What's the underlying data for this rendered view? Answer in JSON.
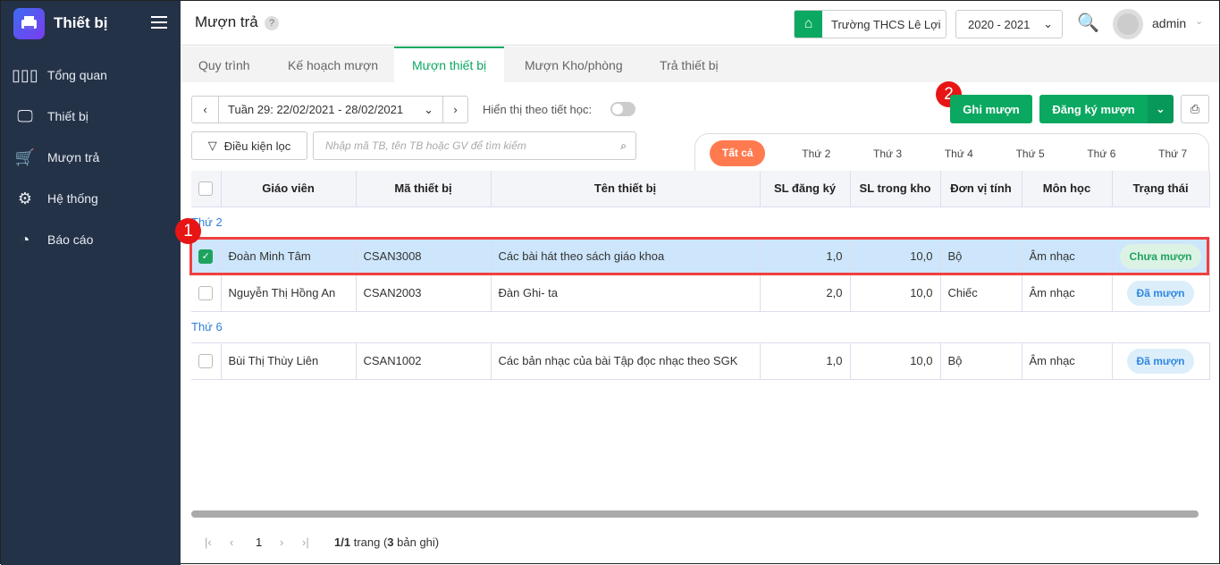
{
  "sidebar": {
    "brand": "Thiết bị",
    "items": [
      {
        "label": "Tổng quan",
        "icon": "bar-chart-icon"
      },
      {
        "label": "Thiết bị",
        "icon": "monitor-icon"
      },
      {
        "label": "Mượn trả",
        "icon": "cart-icon"
      },
      {
        "label": "Hệ thống",
        "icon": "gear-icon"
      },
      {
        "label": "Báo cáo",
        "icon": "pie-chart-icon"
      }
    ]
  },
  "header": {
    "title": "Mượn trả",
    "help": "?",
    "school": "Trường THCS Lê Lợi",
    "year": "2020 - 2021",
    "user": "admin"
  },
  "tabs": [
    "Quy trình",
    "Kế hoạch mượn",
    "Mượn thiết bị",
    "Mượn Kho/phòng",
    "Trả thiết bị"
  ],
  "toolbar": {
    "week": "Tuần 29: 22/02/2021 - 28/02/2021",
    "toggle_label": "Hiển thị theo tiết học:",
    "filter": "Điều kiện lọc",
    "search_placeholder": "Nhập mã TB, tên TB hoặc GV để tìm kiếm",
    "ghi_muon": "Ghi mượn",
    "dang_ky": "Đăng ký mượn",
    "badge1": "1",
    "badge2": "2"
  },
  "days": [
    "Tất cả",
    "Thứ 2",
    "Thứ 3",
    "Thứ 4",
    "Thứ 5",
    "Thứ 6",
    "Thứ 7"
  ],
  "columns": [
    "Giáo viên",
    "Mã thiết bị",
    "Tên thiết bị",
    "SL đăng ký",
    "SL trong kho",
    "Đơn vị tính",
    "Môn học",
    "Trạng thái"
  ],
  "groups": [
    {
      "label": "Thứ 2",
      "rows": [
        {
          "teacher": "Đoàn Minh Tâm",
          "code": "CSAN3008",
          "name": "Các bài hát theo sách giáo khoa",
          "qty": "1,0",
          "stock": "10,0",
          "unit": "Bộ",
          "subject": "Âm nhạc",
          "status": "Chưa mượn",
          "checked": true
        },
        {
          "teacher": "Nguyễn Thị Hồng An",
          "code": "CSAN2003",
          "name": "Đàn Ghi- ta",
          "qty": "2,0",
          "stock": "10,0",
          "unit": "Chiếc",
          "subject": "Âm nhạc",
          "status": "Đã mượn",
          "checked": false
        }
      ]
    },
    {
      "label": "Thứ 6",
      "rows": [
        {
          "teacher": "Bùi Thị Thùy Liên",
          "code": "CSAN1002",
          "name": "Các bản nhạc của bài Tập đọc nhạc theo SGK",
          "qty": "1,0",
          "stock": "10,0",
          "unit": "Bộ",
          "subject": "Âm nhạc",
          "status": "Đã mượn",
          "checked": false
        }
      ]
    }
  ],
  "pager": {
    "page": "1",
    "pages": "1/1",
    "trang": "trang (",
    "count": "3",
    "records": "bản ghi)"
  }
}
